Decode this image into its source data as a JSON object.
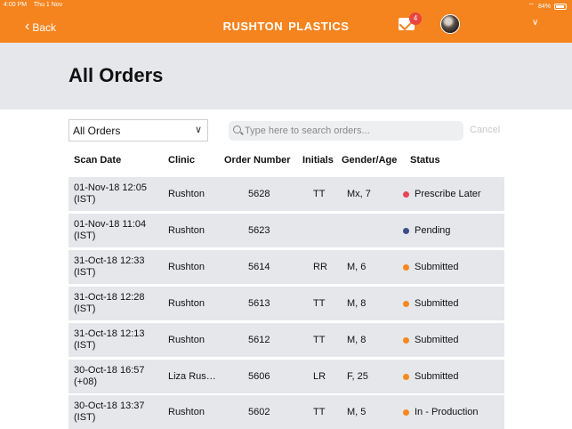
{
  "status_bar": {
    "time": "4:00 PM",
    "date": "Thu 1 Nov",
    "battery": "84%"
  },
  "nav": {
    "back_label": "Back",
    "brand_word1": "RUSHTON",
    "brand_word2": "PLASTICS",
    "mail_count": "4"
  },
  "page": {
    "title": "All Orders"
  },
  "filter": {
    "selected": "All Orders"
  },
  "search": {
    "placeholder": "Type here to search orders...",
    "cancel_label": "Cancel"
  },
  "table": {
    "headers": [
      "Scan Date",
      "Clinic",
      "Order Number",
      "Initials",
      "Gender/Age",
      "Status"
    ],
    "rows": [
      {
        "date1": "01-Nov-18 12:05",
        "date2": "(IST)",
        "clinic": "Rushton",
        "order": "5628",
        "initials": "TT",
        "gender": "Mx, 7",
        "status": "Prescribe Later",
        "status_color": "#e8455a"
      },
      {
        "date1": "01-Nov-18 11:04",
        "date2": "(IST)",
        "clinic": "Rushton",
        "order": "5623",
        "initials": "",
        "gender": "",
        "status": "Pending",
        "status_color": "#3a4f8a"
      },
      {
        "date1": "31-Oct-18 12:33",
        "date2": "(IST)",
        "clinic": "Rushton",
        "order": "5614",
        "initials": "RR",
        "gender": "M, 6",
        "status": "Submitted",
        "status_color": "#f5891f"
      },
      {
        "date1": "31-Oct-18 12:28",
        "date2": "(IST)",
        "clinic": "Rushton",
        "order": "5613",
        "initials": "TT",
        "gender": "M, 8",
        "status": "Submitted",
        "status_color": "#f5891f"
      },
      {
        "date1": "31-Oct-18 12:13",
        "date2": "(IST)",
        "clinic": "Rushton",
        "order": "5612",
        "initials": "TT",
        "gender": "M, 8",
        "status": "Submitted",
        "status_color": "#f5891f"
      },
      {
        "date1": "30-Oct-18 16:57",
        "date2": "(+08)",
        "clinic": "Liza Rus…",
        "order": "5606",
        "initials": "LR",
        "gender": "F, 25",
        "status": "Submitted",
        "status_color": "#f5891f"
      },
      {
        "date1": "30-Oct-18 13:37",
        "date2": "(IST)",
        "clinic": "Rushton",
        "order": "5602",
        "initials": "TT",
        "gender": "M, 5",
        "status": "In - Production",
        "status_color": "#f5891f"
      }
    ]
  }
}
